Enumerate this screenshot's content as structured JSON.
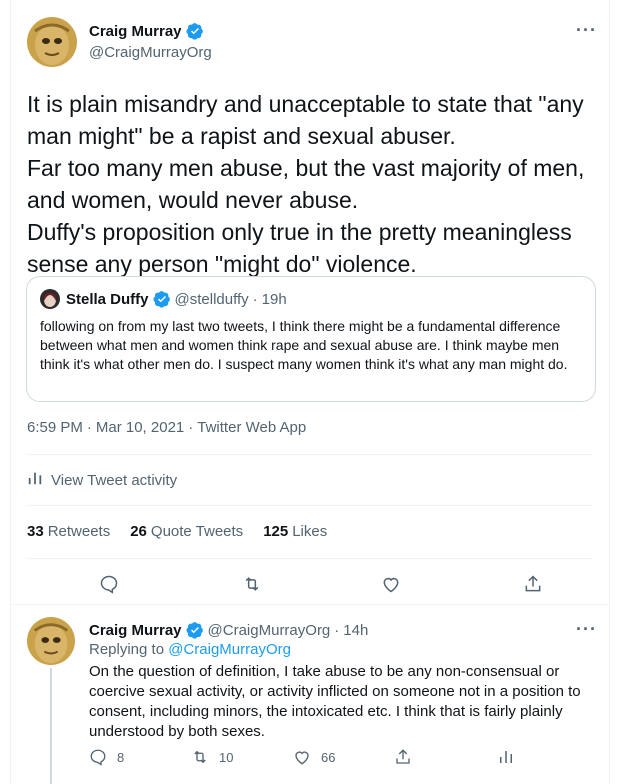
{
  "main_tweet": {
    "author_name": "Craig Murray",
    "author_handle": "@CraigMurrayOrg",
    "more_label": "···",
    "text": "It is plain misandry and unacceptable to state that \"any man might\" be a rapist and sexual abuser.\nFar too many men abuse, but the vast majority of men, and women,  would never abuse.\nDuffy's proposition only true in the pretty meaningless sense any person \"might do\" violence.",
    "quote": {
      "author_name": "Stella Duffy",
      "author_handle": "@stellduffy",
      "separator": "·",
      "time": "19h",
      "text": "following on from my last two tweets, I think there might be a fundamental difference between what men and women think rape and sexual abuse are. I think maybe men think it's what other men do. I suspect many women think it's what any man might do."
    },
    "time": "6:59 PM",
    "dot": "·",
    "date": "Mar 10, 2021",
    "source": "Twitter Web App",
    "activity_label": "View Tweet activity",
    "stats": {
      "retweets_count": "33",
      "retweets_label": "Retweets",
      "quotes_count": "26",
      "quotes_label": "Quote Tweets",
      "likes_count": "125",
      "likes_label": "Likes"
    },
    "actions": [
      "reply-icon",
      "retweet-icon",
      "like-icon",
      "share-icon"
    ]
  },
  "reply_tweet": {
    "author_name": "Craig Murray",
    "author_handle": "@CraigMurrayOrg",
    "separator": "·",
    "time": "14h",
    "more_label": "···",
    "replying_prefix": "Replying to",
    "replying_to": "@CraigMurrayOrg",
    "text": "On the question of definition, I take abuse to be any non-consensual or coercive sexual activity, or activity inflicted on someone not in a position to consent, including minors, the intoxicated etc. I think that is fairly plainly understood by both sexes.",
    "reply_count": "8",
    "retweet_count": "10",
    "like_count": "66"
  },
  "colors": {
    "accent": "#1d9bf0",
    "secondary_text": "#536471",
    "border": "#cfd9de"
  }
}
